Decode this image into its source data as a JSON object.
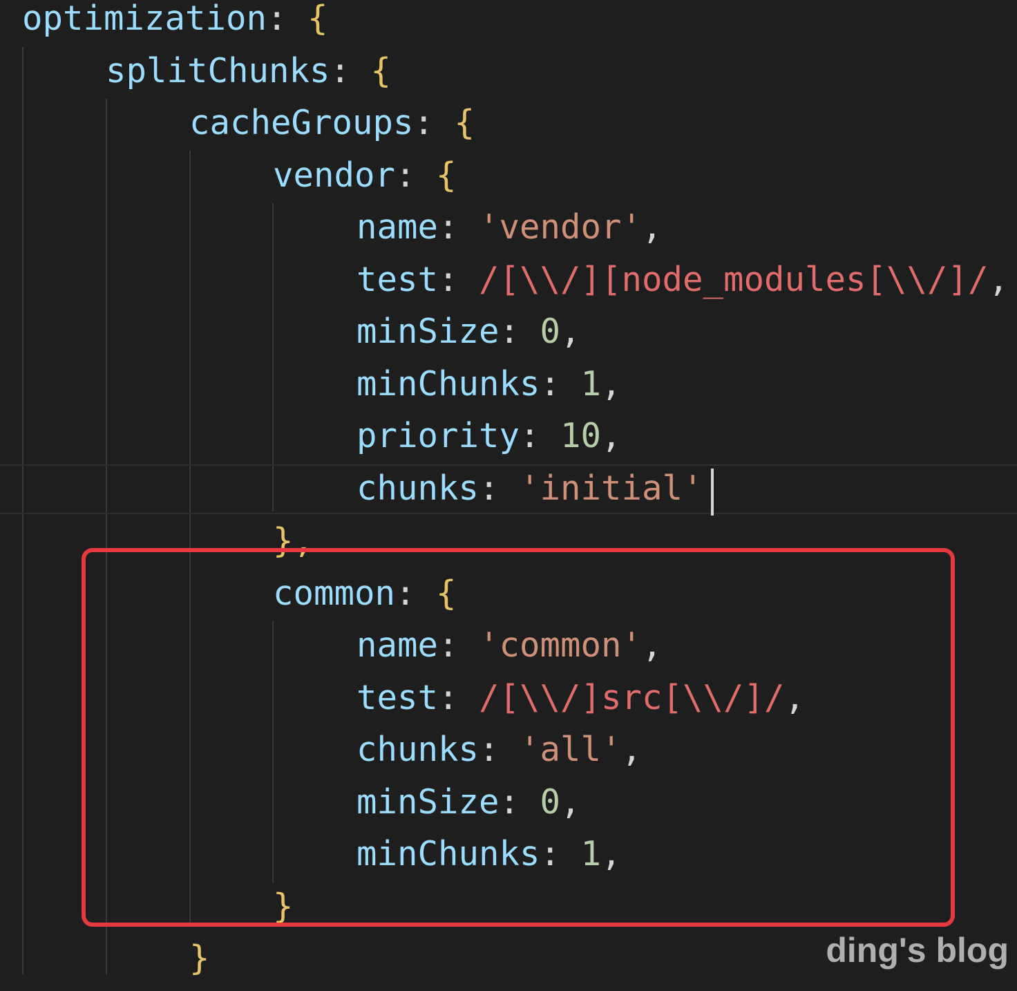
{
  "code_lines": [
    {
      "tokens": [
        {
          "t": "optimization",
          "c": "key"
        },
        {
          "t": ": ",
          "c": "punct"
        },
        {
          "t": "{",
          "c": "brace"
        }
      ]
    },
    {
      "tokens": [
        {
          "t": "splitChunks",
          "c": "key"
        },
        {
          "t": ": ",
          "c": "punct"
        },
        {
          "t": "{",
          "c": "brace"
        }
      ]
    },
    {
      "tokens": [
        {
          "t": "cacheGroups",
          "c": "key"
        },
        {
          "t": ": ",
          "c": "punct"
        },
        {
          "t": "{",
          "c": "brace"
        }
      ]
    },
    {
      "tokens": [
        {
          "t": "vendor",
          "c": "key"
        },
        {
          "t": ": ",
          "c": "punct"
        },
        {
          "t": "{",
          "c": "brace"
        }
      ]
    },
    {
      "tokens": [
        {
          "t": "name",
          "c": "key"
        },
        {
          "t": ": ",
          "c": "punct"
        },
        {
          "t": "'vendor'",
          "c": "string"
        },
        {
          "t": ",",
          "c": "punct"
        }
      ]
    },
    {
      "tokens": [
        {
          "t": "test",
          "c": "key"
        },
        {
          "t": ": ",
          "c": "punct"
        },
        {
          "t": "/[\\\\/][node_modules[\\\\/]/",
          "c": "regex"
        },
        {
          "t": ",",
          "c": "punct"
        }
      ]
    },
    {
      "tokens": [
        {
          "t": "minSize",
          "c": "key"
        },
        {
          "t": ": ",
          "c": "punct"
        },
        {
          "t": "0",
          "c": "number"
        },
        {
          "t": ",",
          "c": "punct"
        }
      ]
    },
    {
      "tokens": [
        {
          "t": "minChunks",
          "c": "key"
        },
        {
          "t": ": ",
          "c": "punct"
        },
        {
          "t": "1",
          "c": "number"
        },
        {
          "t": ",",
          "c": "punct"
        }
      ]
    },
    {
      "tokens": [
        {
          "t": "priority",
          "c": "key"
        },
        {
          "t": ": ",
          "c": "punct"
        },
        {
          "t": "10",
          "c": "number"
        },
        {
          "t": ",",
          "c": "punct"
        }
      ]
    },
    {
      "tokens": [
        {
          "t": "chunks",
          "c": "key"
        },
        {
          "t": ": ",
          "c": "punct"
        },
        {
          "t": "'initial'",
          "c": "string"
        }
      ]
    },
    {
      "tokens": [
        {
          "t": "},",
          "c": "brace"
        }
      ]
    },
    {
      "tokens": [
        {
          "t": "common",
          "c": "key"
        },
        {
          "t": ": ",
          "c": "punct"
        },
        {
          "t": "{",
          "c": "brace"
        }
      ]
    },
    {
      "tokens": [
        {
          "t": "name",
          "c": "key"
        },
        {
          "t": ": ",
          "c": "punct"
        },
        {
          "t": "'common'",
          "c": "string"
        },
        {
          "t": ",",
          "c": "punct"
        }
      ]
    },
    {
      "tokens": [
        {
          "t": "test",
          "c": "key"
        },
        {
          "t": ": ",
          "c": "punct"
        },
        {
          "t": "/[\\\\/]src[\\\\/]/",
          "c": "regex"
        },
        {
          "t": ",",
          "c": "punct"
        }
      ]
    },
    {
      "tokens": [
        {
          "t": "chunks",
          "c": "key"
        },
        {
          "t": ": ",
          "c": "punct"
        },
        {
          "t": "'all'",
          "c": "string"
        },
        {
          "t": ",",
          "c": "punct"
        }
      ]
    },
    {
      "tokens": [
        {
          "t": "minSize",
          "c": "key"
        },
        {
          "t": ": ",
          "c": "punct"
        },
        {
          "t": "0",
          "c": "number"
        },
        {
          "t": ",",
          "c": "punct"
        }
      ]
    },
    {
      "tokens": [
        {
          "t": "minChunks",
          "c": "key"
        },
        {
          "t": ": ",
          "c": "punct"
        },
        {
          "t": "1",
          "c": "number"
        },
        {
          "t": ",",
          "c": "punct"
        }
      ]
    },
    {
      "tokens": [
        {
          "t": "}",
          "c": "brace"
        }
      ]
    },
    {
      "tokens": [
        {
          "t": "}",
          "c": "brace"
        }
      ]
    }
  ],
  "watermark": "ding's blog",
  "colors": {
    "background": "#1e1e1e",
    "key": "#9cdcfe",
    "punct": "#d4d4d4",
    "brace": "#e8c468",
    "string": "#ce9178",
    "regex": "#e06c6c",
    "number": "#b5cea8",
    "highlight_border": "#e5393f"
  }
}
